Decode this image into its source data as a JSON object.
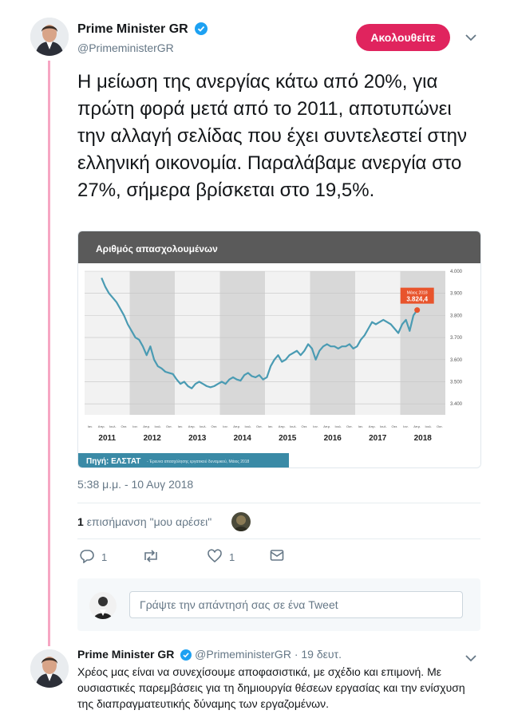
{
  "tweet": {
    "author_name": "Prime Minister GR",
    "author_handle": "@PrimeministerGR",
    "follow_label": "Ακολουθείτε",
    "text": "Η μείωση της ανεργίας κάτω από 20%, για πρώτη φορά μετά από το 2011, αποτυπώνει την αλλαγή σελίδας που έχει συντελεστεί στην ελληνική οικονομία. Παραλάβαμε ανεργία στο 27%, σήμερα βρίσκεται στο 19,5%.",
    "timestamp": "5:38 μ.μ. - 10 Αυγ 2018",
    "likes_count": "1",
    "likes_label": "επισήμανση \"μου αρέσει\"",
    "reply_count": "1",
    "like_action_count": "1",
    "reply_placeholder": "Γράψτε την απάντησή σας σε ένα Tweet"
  },
  "chart_image": {
    "title": "Αριθμός απασχολουμένων",
    "source_label": "Πηγή: ΕΛΣΤΑΤ",
    "source_detail": "- Έρευνα απασχόλησης εργατικού δυναμικού, Μάιος 2018",
    "callout_month": "Μάιος 2018",
    "callout_value": "3.824,4",
    "months": [
      "Ιαν.",
      "Απρ.",
      "Ιουλ.",
      "Οκτ."
    ],
    "years": [
      "2011",
      "2012",
      "2013",
      "2014",
      "2015",
      "2016",
      "2017",
      "2018"
    ]
  },
  "chart_data": {
    "type": "line",
    "title": "Αριθμός απασχολουμένων",
    "ylim": [
      3350,
      4000
    ],
    "yticks": [
      "4.000",
      "3.900",
      "3.800",
      "3.700",
      "3.600",
      "3.500",
      "3.400"
    ],
    "ytick_values": [
      4000,
      3900,
      3800,
      3700,
      3600,
      3500,
      3400
    ],
    "x_start": "2011-01",
    "x_end": "2018-12",
    "x": [
      "2011-05",
      "2011-06",
      "2011-07",
      "2011-08",
      "2011-09",
      "2011-10",
      "2011-11",
      "2011-12",
      "2012-01",
      "2012-02",
      "2012-03",
      "2012-04",
      "2012-05",
      "2012-06",
      "2012-07",
      "2012-08",
      "2012-09",
      "2012-10",
      "2012-11",
      "2012-12",
      "2013-01",
      "2013-02",
      "2013-03",
      "2013-04",
      "2013-05",
      "2013-06",
      "2013-07",
      "2013-08",
      "2013-09",
      "2013-10",
      "2013-11",
      "2013-12",
      "2014-01",
      "2014-02",
      "2014-03",
      "2014-04",
      "2014-05",
      "2014-06",
      "2014-07",
      "2014-08",
      "2014-09",
      "2014-10",
      "2014-11",
      "2014-12",
      "2015-01",
      "2015-02",
      "2015-03",
      "2015-04",
      "2015-05",
      "2015-06",
      "2015-07",
      "2015-08",
      "2015-09",
      "2015-10",
      "2015-11",
      "2015-12",
      "2016-01",
      "2016-02",
      "2016-03",
      "2016-04",
      "2016-05",
      "2016-06",
      "2016-07",
      "2016-08",
      "2016-09",
      "2016-10",
      "2016-11",
      "2016-12",
      "2017-01",
      "2017-02",
      "2017-03",
      "2017-04",
      "2017-05",
      "2017-06",
      "2017-07",
      "2017-08",
      "2017-09",
      "2017-10",
      "2017-11",
      "2017-12",
      "2018-01",
      "2018-02",
      "2018-03",
      "2018-04",
      "2018-05"
    ],
    "values": [
      3970,
      3930,
      3900,
      3880,
      3860,
      3830,
      3800,
      3760,
      3730,
      3700,
      3690,
      3660,
      3620,
      3660,
      3600,
      3570,
      3560,
      3545,
      3540,
      3535,
      3510,
      3490,
      3500,
      3480,
      3470,
      3490,
      3500,
      3490,
      3480,
      3475,
      3480,
      3490,
      3500,
      3490,
      3510,
      3520,
      3510,
      3505,
      3530,
      3540,
      3525,
      3520,
      3530,
      3510,
      3520,
      3570,
      3600,
      3620,
      3590,
      3600,
      3620,
      3630,
      3640,
      3620,
      3640,
      3670,
      3650,
      3600,
      3640,
      3660,
      3670,
      3660,
      3660,
      3650,
      3660,
      3660,
      3670,
      3650,
      3660,
      3690,
      3710,
      3740,
      3770,
      3760,
      3770,
      3780,
      3770,
      3760,
      3740,
      3720,
      3760,
      3780,
      3730,
      3800,
      3824.4
    ],
    "annotation": {
      "x": "2018-05",
      "label": "Μάιος 2018",
      "value": "3.824,4"
    },
    "colors": {
      "line": "#4a9bb3",
      "marker": "#e8542c",
      "shade": "#d8d8d8",
      "plot_bg": "#f2f2f2",
      "header_bg": "#5a5a5a"
    }
  },
  "second_tweet": {
    "author_name": "Prime Minister GR",
    "author_handle": "@PrimeministerGR",
    "time_label": "· 19 δευτ.",
    "text": "Χρέος μας είναι να συνεχίσουμε αποφασιστικά, με σχέδιο και επιμονή. Με ουσιαστικές παρεμβάσεις για τη δημιουργία θέσεων εργασίας και την ενίσχυση της διαπραγματευτικής δύναμης των εργαζομένων."
  },
  "icons": {
    "verified": "verified-badge-icon",
    "reply": "reply-icon",
    "retweet": "retweet-icon",
    "like": "heart-icon",
    "dm": "envelope-icon",
    "caret": "chevron-down-icon"
  },
  "colors": {
    "follow_button": "#e0245e",
    "thread_line": "#f6a6c3",
    "verified": "#1da1f2"
  }
}
